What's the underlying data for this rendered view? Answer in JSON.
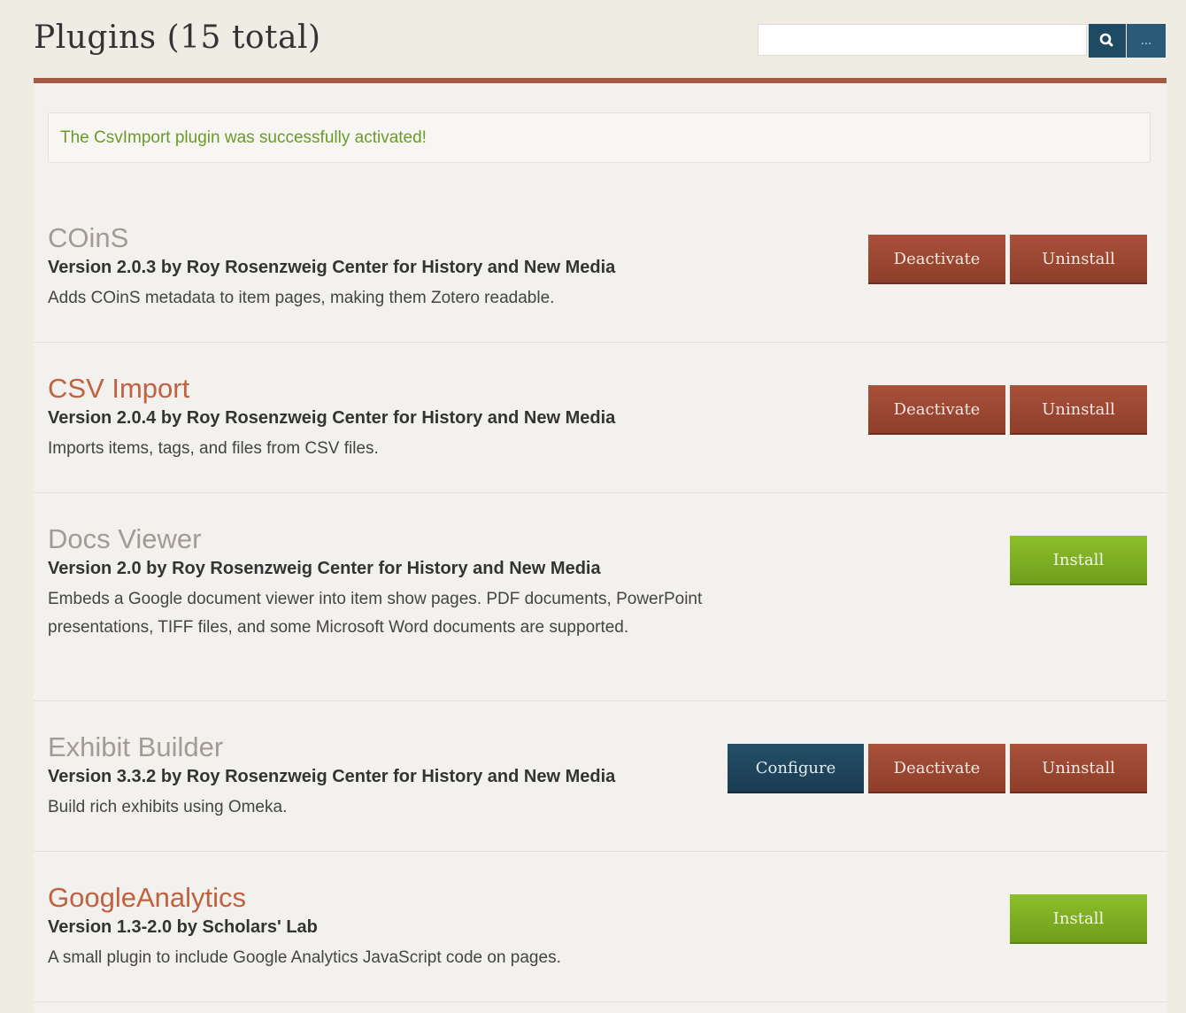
{
  "header": {
    "title": "Plugins (15 total)",
    "search_placeholder": "",
    "advanced_label": "..."
  },
  "flash_message": "The CsvImport plugin was successfully activated!",
  "plugins": [
    {
      "name": "COinS",
      "meta": "Version 2.0.3 by Roy Rosenzweig Center for History and New Media",
      "description": "Adds COinS metadata to item pages, making them Zotero readable.",
      "status": "active",
      "actions": [
        "Deactivate",
        "Uninstall"
      ]
    },
    {
      "name": "CSV Import",
      "meta": "Version 2.0.4 by Roy Rosenzweig Center for History and New Media",
      "description": "Imports items, tags, and files from CSV files.",
      "status": "active",
      "actions": [
        "Deactivate",
        "Uninstall"
      ]
    },
    {
      "name": "Docs Viewer",
      "meta": "Version 2.0 by Roy Rosenzweig Center for History and New Media",
      "description": "Embeds a Google document viewer into item show pages. PDF documents, PowerPoint presentations, TIFF files, and some Microsoft Word documents are supported.",
      "status": "not installed",
      "actions": [
        "Install"
      ]
    },
    {
      "name": "Exhibit Builder",
      "meta": "Version 3.3.2 by Roy Rosenzweig Center for History and New Media",
      "description": "Build rich exhibits using Omeka.",
      "status": "active",
      "actions": [
        "Configure",
        "Deactivate",
        "Uninstall"
      ]
    },
    {
      "name": "GoogleAnalytics",
      "meta": "Version 1.3-2.0 by Scholars' Lab",
      "description": "A small plugin to include Google Analytics JavaScript code on pages.",
      "status": "not installed",
      "actions": [
        "Install"
      ]
    }
  ],
  "colors": {
    "accent_red": "#a45a45",
    "button_red": "#9a4733",
    "button_green": "#7fb024",
    "button_blue": "#1f4a63",
    "success_text": "#6a9a2a"
  },
  "icons": {
    "search": "search-icon"
  }
}
